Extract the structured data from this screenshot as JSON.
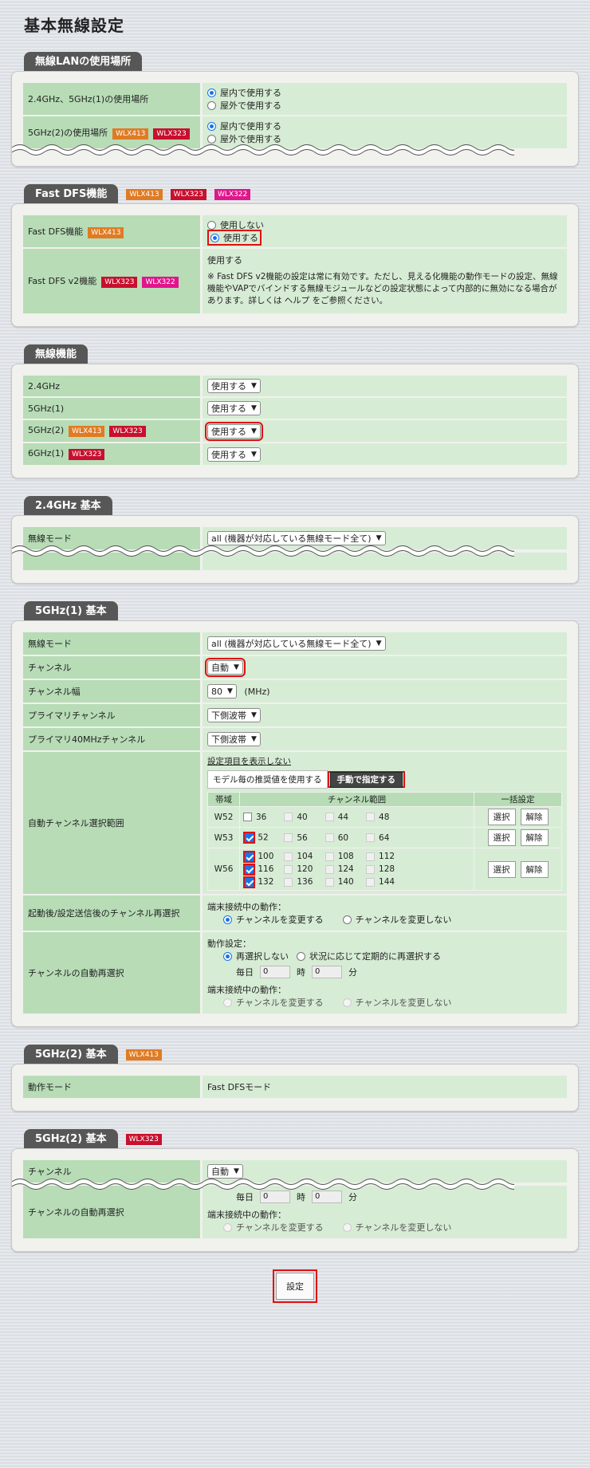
{
  "page_title": "基本無線設定",
  "badges": {
    "wlx413": "WLX413",
    "wlx323": "WLX323",
    "wlx322": "WLX322"
  },
  "sec_location": {
    "title": "無線LANの使用場所",
    "row1_label": "2.4GHz、5GHz(1)の使用場所",
    "row2_label": "5GHz(2)の使用場所",
    "opt_indoor": "屋内で使用する",
    "opt_outdoor": "屋外で使用する"
  },
  "sec_fastdfs": {
    "title": "Fast DFS機能",
    "row1_label": "Fast DFS機能",
    "opt_no": "使用しない",
    "opt_yes": "使用する",
    "row2_label": "Fast DFS v2機能",
    "v2_value": "使用する",
    "v2_note": "※ Fast DFS v2機能の設定は常に有効です。ただし、見える化機能の動作モードの設定、無線機能やVAPでバインドする無線モジュールなどの設定状態によって内部的に無効になる場合があります。詳しくは ヘルプ をご参照ください。"
  },
  "sec_radio": {
    "title": "無線機能",
    "r1": "2.4GHz",
    "r2": "5GHz(1)",
    "r3": "5GHz(2)",
    "r4": "6GHz(1)",
    "value": "使用する"
  },
  "sec_24": {
    "title": "2.4GHz 基本",
    "mode_label": "無線モード",
    "mode_value": "all (機器が対応している無線モード全て)"
  },
  "sec_5g1": {
    "title": "5GHz(1) 基本",
    "mode_label": "無線モード",
    "mode_value": "all (機器が対応している無線モード全て)",
    "ch_label": "チャンネル",
    "ch_value": "自動",
    "width_label": "チャンネル幅",
    "width_value": "80",
    "width_unit": "(MHz)",
    "primary_label": "プライマリチャンネル",
    "primary_value": "下側波帯",
    "primary40_label": "プライマリ40MHzチャンネル",
    "primary40_value": "下側波帯",
    "auto_label": "自動チャンネル選択範囲",
    "hide_link": "設定項目を表示しない",
    "btn_model": "モデル毎の推奨値を使用する",
    "btn_manual": "手動で指定する",
    "th_band": "帯域",
    "th_range": "チャンネル範囲",
    "th_bulk": "一括設定",
    "bands": [
      {
        "name": "W52",
        "channels": [
          "36",
          "40",
          "44",
          "48"
        ]
      },
      {
        "name": "W53",
        "channels": [
          "52",
          "56",
          "60",
          "64"
        ]
      },
      {
        "name": "W56",
        "channels": [
          "100",
          "104",
          "108",
          "112",
          "116",
          "120",
          "124",
          "128",
          "132",
          "136",
          "140",
          "144"
        ]
      }
    ],
    "btn_select": "選択",
    "btn_clear": "解除",
    "reselect_label": "起動後/設定送信後のチャンネル再選択",
    "during_conn": "端末接続中の動作：",
    "opt_change": "チャンネルを変更する",
    "opt_nochange": "チャンネルを変更しない",
    "auto_resel_label": "チャンネルの自動再選択",
    "op_setting": "動作設定：",
    "opt_noresel": "再選択しない",
    "opt_periodic": "状況に応じて定期的に再選択する",
    "daily": "毎日",
    "hour_unit": "時",
    "min_unit": "分",
    "hour_value": "0",
    "min_value": "0"
  },
  "sec_5g2a": {
    "title": "5GHz(2) 基本",
    "mode_label": "動作モード",
    "mode_value": "Fast DFSモード"
  },
  "sec_5g2b": {
    "title": "5GHz(2) 基本",
    "ch_label": "チャンネル",
    "ch_value": "自動",
    "auto_resel_label": "チャンネルの自動再選択",
    "daily": "毎日",
    "hour_value": "0",
    "min_value": "0",
    "hour_unit": "時",
    "min_unit": "分",
    "during_conn": "端末接続中の動作：",
    "opt_change": "チャンネルを変更する",
    "opt_nochange": "チャンネルを変更しない"
  },
  "submit_label": "設定"
}
